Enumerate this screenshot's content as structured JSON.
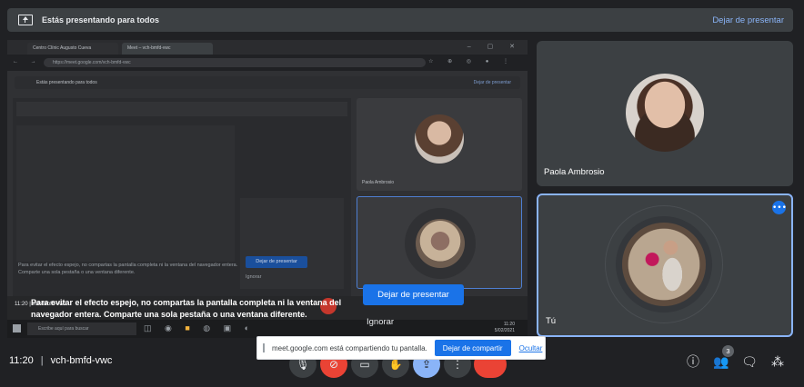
{
  "banner": {
    "title": "Estás presentando para todos",
    "stop_label": "Dejar de presentar",
    "icon": "present-to-all-icon"
  },
  "mirror": {
    "tabs": [
      "Centro Clínic Augusto Cueva",
      "Meet – vch-bmfd-vwc"
    ],
    "address": "https://meet.google.com/vch-bmfd-vwc",
    "banner_title": "Estás presentando para todos",
    "banner_stop": "Dejar de presentar",
    "warning": "Para evitar el efecto espejo, no compartas la pantalla completa ni la ventana del navegador entera. Comparte una sola pestaña o una ventana diferente.",
    "stop_button": "Dejar de presentar",
    "ignore": "Ignorar",
    "tile_name": "Paola Ambrosio",
    "code": "11:20 | vch-bmfd-vwc",
    "taskbar_search": "Escribe aquí para buscar",
    "taskbar_time": "11:20",
    "taskbar_date": "5/02/2021"
  },
  "warning": {
    "text": "Para evitar el efecto espejo, no compartas la pantalla completa ni la ventana del navegador entera. Comparte una sola pestaña o una ventana diferente.",
    "stop_button": "Dejar de presentar",
    "ignore": "Ignorar"
  },
  "participants": [
    {
      "name": "Paola Ambrosio"
    },
    {
      "name": "Tú"
    }
  ],
  "bottom": {
    "time": "11:20",
    "separator": "|",
    "meeting_code": "vch-bmfd-vwc",
    "people_count": "3"
  },
  "toast": {
    "message": "meet.google.com está compartiendo tu pantalla.",
    "share_button": "Dejar de compartir",
    "hide": "Ocultar"
  },
  "colors": {
    "accent": "#1a73e8",
    "link": "#8ab4f8",
    "danger": "#ea4335",
    "background": "#202124",
    "tile": "#3c4043"
  }
}
